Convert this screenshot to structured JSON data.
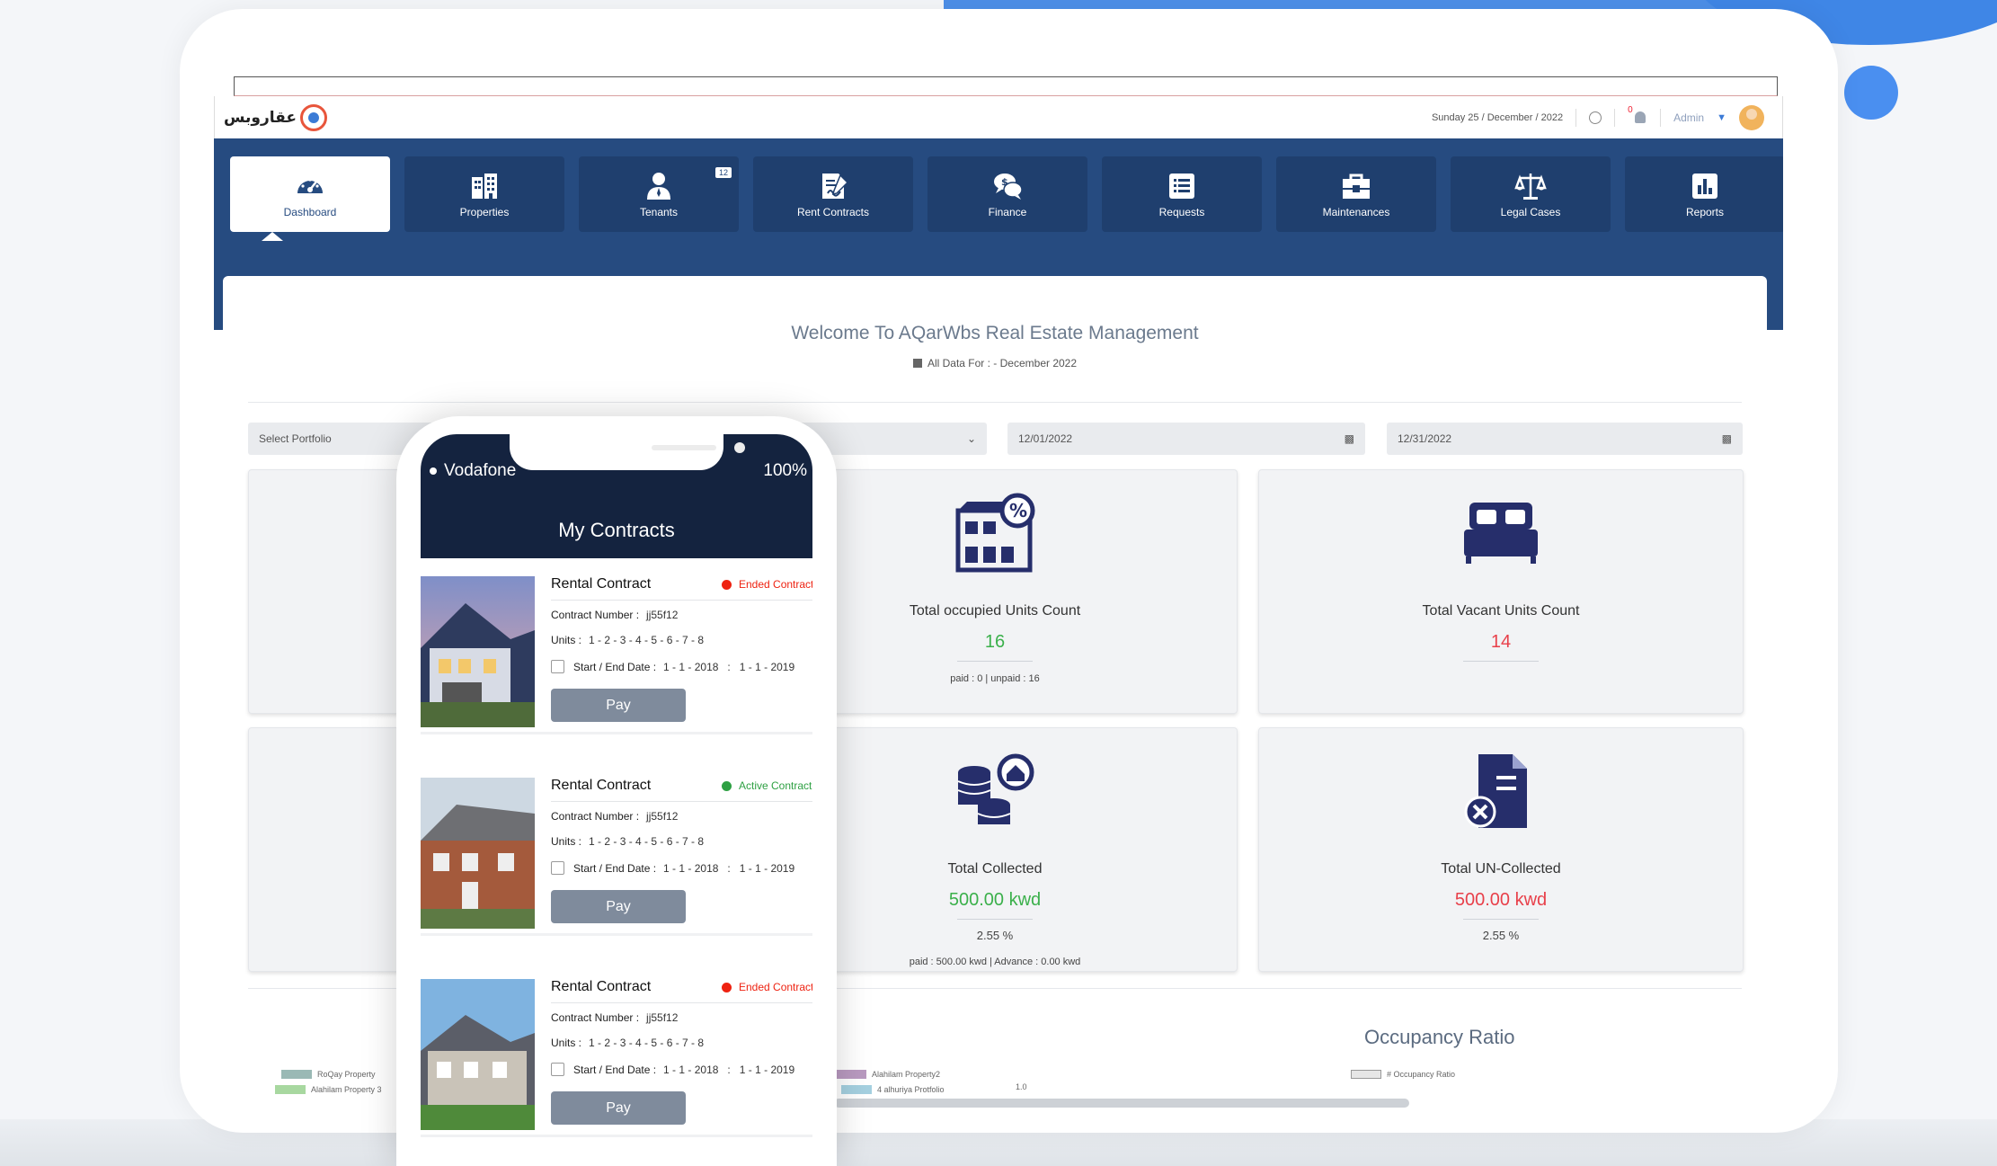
{
  "topbar": {
    "logo_text": "عقاروبس",
    "date": "Sunday 25 / December / 2022",
    "notif_count": "0",
    "user": "Admin"
  },
  "nav": [
    {
      "label": "Dashboard",
      "icon": "gauge-icon"
    },
    {
      "label": "Properties",
      "icon": "building-icon"
    },
    {
      "label": "Tenants",
      "icon": "person-icon",
      "badge": "12"
    },
    {
      "label": "Rent Contracts",
      "icon": "contract-icon"
    },
    {
      "label": "Finance",
      "icon": "finance-chat-icon"
    },
    {
      "label": "Requests",
      "icon": "list-icon"
    },
    {
      "label": "Maintenances",
      "icon": "toolbox-icon"
    },
    {
      "label": "Legal Cases",
      "icon": "scales-icon"
    },
    {
      "label": "Reports",
      "icon": "report-chart-icon"
    }
  ],
  "main": {
    "welcome": "Welcome To AQarWbs Real Estate Management",
    "all_data": "All Data For : - December 2022",
    "portfolio_placeholder": "Select Portfolio",
    "date_from": "12/01/2022",
    "date_to": "12/31/2022"
  },
  "cards": {
    "occupied": {
      "title": "Total occupied Units Count",
      "value": "16",
      "meta": "paid : 0  |  unpaid : 16"
    },
    "vacant": {
      "title": "Total Vacant Units Count",
      "value": "14"
    },
    "collected": {
      "title": "Total Collected",
      "value": "500.00 kwd",
      "pct": "2.55 %",
      "meta": "paid : 500.00 kwd  |  Advance : 0.00 kwd"
    },
    "uncollected": {
      "title": "Total UN-Collected",
      "value": "500.00 kwd",
      "pct": "2.55 %"
    }
  },
  "chart": {
    "title": "Occupancy Ratio",
    "legend_occupancy": "# Occupancy Ratio",
    "tick": "1.0",
    "legend_left": [
      "RoQay Property",
      "Alahilam Property 3"
    ],
    "legend_mid": [
      "Alahilam Property2",
      "4 alhuriya Protfolio"
    ]
  },
  "phone": {
    "carrier": "Vodafone",
    "battery": "100%",
    "title": "My Contracts",
    "pay_label": "Pay",
    "labels": {
      "number": "Contract Number :",
      "units": "Units :",
      "dates": "Start / End Date :"
    },
    "contracts": [
      {
        "title": "Rental Contract",
        "status": "Ended Contract",
        "number": "jj55f12",
        "units": "1 - 2 - 3 - 4 - 5 - 6 - 7 - 8",
        "start": "1 - 1 - 2018",
        "end": "1 - 1 - 2019"
      },
      {
        "title": "Rental Contract",
        "status": "Active Contract",
        "number": "jj55f12",
        "units": "1 - 2 - 3 - 4 - 5 - 6 - 7 - 8",
        "start": "1 - 1 - 2018",
        "end": "1 - 1 - 2019"
      },
      {
        "title": "Rental Contract",
        "status": "Ended Contract",
        "number": "jj55f12",
        "units": "1 - 2 - 3 - 4 - 5 - 6 - 7 - 8",
        "start": "1 - 1 - 2018",
        "end": "1 - 1 - 2019"
      }
    ]
  },
  "colors": {
    "primary": "#264b80",
    "success": "#3bb04b",
    "danger": "#e8404a",
    "accent": "#4a8ff0"
  }
}
